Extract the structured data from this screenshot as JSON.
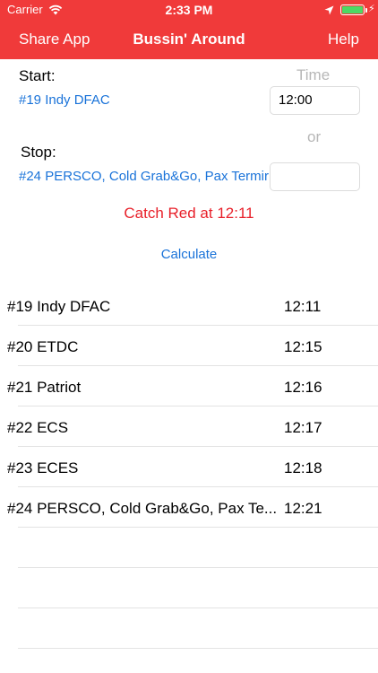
{
  "status_bar": {
    "carrier": "Carrier",
    "time": "2:33 PM",
    "battery_color": "#4cd964"
  },
  "nav": {
    "left_button": "Share App",
    "title": "Bussin' Around",
    "right_button": "Help",
    "background_color": "#f03a3a"
  },
  "form": {
    "start_label": "Start:",
    "start_value": "#19 Indy DFAC",
    "time_header": "Time",
    "start_time": "12:00",
    "or_label": "or",
    "stop_label": "Stop:",
    "stop_value": "#24 PERSCO, Cold Grab&Go, Pax Termir",
    "stop_time": ""
  },
  "result": {
    "catch_text": "Catch Red at 12:11",
    "calculate_label": "Calculate"
  },
  "schedule": [
    {
      "stop": "#19 Indy DFAC",
      "time": "12:11"
    },
    {
      "stop": "#20 ETDC",
      "time": "12:15"
    },
    {
      "stop": "#21 Patriot",
      "time": "12:16"
    },
    {
      "stop": "#22 ECS",
      "time": "12:17"
    },
    {
      "stop": "#23 ECES",
      "time": "12:18"
    },
    {
      "stop": "#24 PERSCO, Cold Grab&Go, Pax Te...",
      "time": "12:21"
    },
    {
      "stop": "",
      "time": ""
    },
    {
      "stop": "",
      "time": ""
    },
    {
      "stop": "",
      "time": ""
    }
  ],
  "colors": {
    "accent_red": "#f03a3a",
    "link_blue": "#1a73d9",
    "catch_red": "#e8202a"
  }
}
